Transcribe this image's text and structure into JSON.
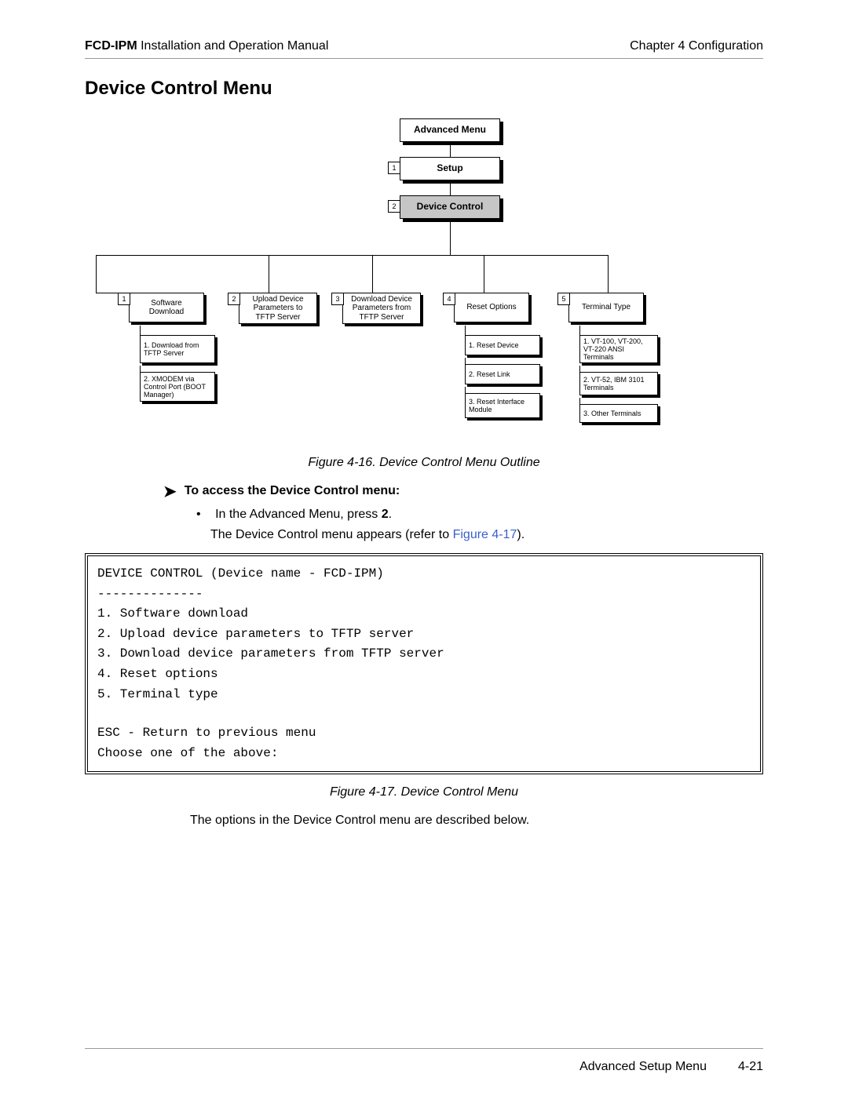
{
  "header": {
    "product": "FCD-IPM",
    "doc": " Installation and Operation Manual",
    "chapter": "Chapter 4  Configuration"
  },
  "section_title": "Device Control Menu",
  "diagram": {
    "top0": "Advanced Menu",
    "top1_num": "1",
    "top1": "Setup",
    "top2_num": "2",
    "top2": "Device Control",
    "cols": [
      {
        "num": "1",
        "title": "Software Download",
        "opts": [
          "1. Download from TFTP Server",
          "2. XMODEM via Control Port (BOOT Manager)"
        ]
      },
      {
        "num": "2",
        "title": "Upload Device Parameters to TFTP Server",
        "opts": []
      },
      {
        "num": "3",
        "title": "Download Device Parameters from TFTP Server",
        "opts": []
      },
      {
        "num": "4",
        "title": "Reset Options",
        "opts": [
          "1. Reset Device",
          "2. Reset Link",
          "3. Reset Interface Module"
        ]
      },
      {
        "num": "5",
        "title": "Terminal Type",
        "opts": [
          "1. VT-100, VT-200, VT-220 ANSI Terminals",
          "2. VT-52, IBM 3101 Terminals",
          "3. Other Terminals"
        ]
      }
    ]
  },
  "fig16": "Figure 4-16.  Device Control Menu Outline",
  "instr_heading": "To access the Device Control menu:",
  "instr_bullet_pre": "In the Advanced Menu, press ",
  "instr_bullet_bold": "2",
  "instr_bullet_post": ".",
  "instr_line2_pre": "The Device Control menu appears (refer to ",
  "instr_line2_link": "Figure 4-17",
  "instr_line2_post": ").",
  "terminal": {
    "l1": "DEVICE CONTROL (Device name - FCD-IPM)",
    "l2": "--------------",
    "l3": "1. Software download",
    "l4": "2. Upload device parameters to TFTP server",
    "l5": "3. Download device parameters from TFTP server",
    "l6": "4. Reset options",
    "l7": "5. Terminal type",
    "l8": "ESC - Return to previous menu",
    "l9": "Choose one of the above:"
  },
  "fig17": "Figure 4-17.  Device Control Menu",
  "outro": "The options in the Device Control menu are described below.",
  "footer": {
    "section": "Advanced Setup Menu",
    "page": "4-21"
  }
}
